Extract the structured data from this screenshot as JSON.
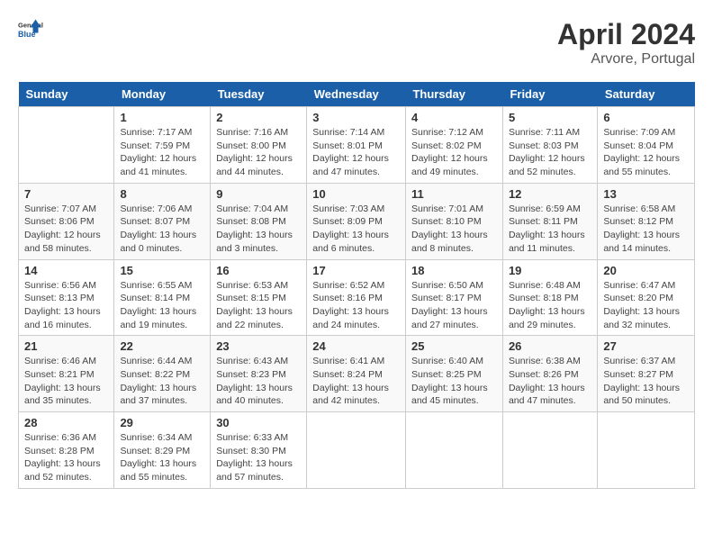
{
  "header": {
    "logo_text_general": "General",
    "logo_text_blue": "Blue",
    "month": "April 2024",
    "location": "Arvore, Portugal"
  },
  "weekdays": [
    "Sunday",
    "Monday",
    "Tuesday",
    "Wednesday",
    "Thursday",
    "Friday",
    "Saturday"
  ],
  "weeks": [
    [
      {
        "day": "",
        "info": ""
      },
      {
        "day": "1",
        "info": "Sunrise: 7:17 AM\nSunset: 7:59 PM\nDaylight: 12 hours\nand 41 minutes."
      },
      {
        "day": "2",
        "info": "Sunrise: 7:16 AM\nSunset: 8:00 PM\nDaylight: 12 hours\nand 44 minutes."
      },
      {
        "day": "3",
        "info": "Sunrise: 7:14 AM\nSunset: 8:01 PM\nDaylight: 12 hours\nand 47 minutes."
      },
      {
        "day": "4",
        "info": "Sunrise: 7:12 AM\nSunset: 8:02 PM\nDaylight: 12 hours\nand 49 minutes."
      },
      {
        "day": "5",
        "info": "Sunrise: 7:11 AM\nSunset: 8:03 PM\nDaylight: 12 hours\nand 52 minutes."
      },
      {
        "day": "6",
        "info": "Sunrise: 7:09 AM\nSunset: 8:04 PM\nDaylight: 12 hours\nand 55 minutes."
      }
    ],
    [
      {
        "day": "7",
        "info": "Sunrise: 7:07 AM\nSunset: 8:06 PM\nDaylight: 12 hours\nand 58 minutes."
      },
      {
        "day": "8",
        "info": "Sunrise: 7:06 AM\nSunset: 8:07 PM\nDaylight: 13 hours\nand 0 minutes."
      },
      {
        "day": "9",
        "info": "Sunrise: 7:04 AM\nSunset: 8:08 PM\nDaylight: 13 hours\nand 3 minutes."
      },
      {
        "day": "10",
        "info": "Sunrise: 7:03 AM\nSunset: 8:09 PM\nDaylight: 13 hours\nand 6 minutes."
      },
      {
        "day": "11",
        "info": "Sunrise: 7:01 AM\nSunset: 8:10 PM\nDaylight: 13 hours\nand 8 minutes."
      },
      {
        "day": "12",
        "info": "Sunrise: 6:59 AM\nSunset: 8:11 PM\nDaylight: 13 hours\nand 11 minutes."
      },
      {
        "day": "13",
        "info": "Sunrise: 6:58 AM\nSunset: 8:12 PM\nDaylight: 13 hours\nand 14 minutes."
      }
    ],
    [
      {
        "day": "14",
        "info": "Sunrise: 6:56 AM\nSunset: 8:13 PM\nDaylight: 13 hours\nand 16 minutes."
      },
      {
        "day": "15",
        "info": "Sunrise: 6:55 AM\nSunset: 8:14 PM\nDaylight: 13 hours\nand 19 minutes."
      },
      {
        "day": "16",
        "info": "Sunrise: 6:53 AM\nSunset: 8:15 PM\nDaylight: 13 hours\nand 22 minutes."
      },
      {
        "day": "17",
        "info": "Sunrise: 6:52 AM\nSunset: 8:16 PM\nDaylight: 13 hours\nand 24 minutes."
      },
      {
        "day": "18",
        "info": "Sunrise: 6:50 AM\nSunset: 8:17 PM\nDaylight: 13 hours\nand 27 minutes."
      },
      {
        "day": "19",
        "info": "Sunrise: 6:48 AM\nSunset: 8:18 PM\nDaylight: 13 hours\nand 29 minutes."
      },
      {
        "day": "20",
        "info": "Sunrise: 6:47 AM\nSunset: 8:20 PM\nDaylight: 13 hours\nand 32 minutes."
      }
    ],
    [
      {
        "day": "21",
        "info": "Sunrise: 6:46 AM\nSunset: 8:21 PM\nDaylight: 13 hours\nand 35 minutes."
      },
      {
        "day": "22",
        "info": "Sunrise: 6:44 AM\nSunset: 8:22 PM\nDaylight: 13 hours\nand 37 minutes."
      },
      {
        "day": "23",
        "info": "Sunrise: 6:43 AM\nSunset: 8:23 PM\nDaylight: 13 hours\nand 40 minutes."
      },
      {
        "day": "24",
        "info": "Sunrise: 6:41 AM\nSunset: 8:24 PM\nDaylight: 13 hours\nand 42 minutes."
      },
      {
        "day": "25",
        "info": "Sunrise: 6:40 AM\nSunset: 8:25 PM\nDaylight: 13 hours\nand 45 minutes."
      },
      {
        "day": "26",
        "info": "Sunrise: 6:38 AM\nSunset: 8:26 PM\nDaylight: 13 hours\nand 47 minutes."
      },
      {
        "day": "27",
        "info": "Sunrise: 6:37 AM\nSunset: 8:27 PM\nDaylight: 13 hours\nand 50 minutes."
      }
    ],
    [
      {
        "day": "28",
        "info": "Sunrise: 6:36 AM\nSunset: 8:28 PM\nDaylight: 13 hours\nand 52 minutes."
      },
      {
        "day": "29",
        "info": "Sunrise: 6:34 AM\nSunset: 8:29 PM\nDaylight: 13 hours\nand 55 minutes."
      },
      {
        "day": "30",
        "info": "Sunrise: 6:33 AM\nSunset: 8:30 PM\nDaylight: 13 hours\nand 57 minutes."
      },
      {
        "day": "",
        "info": ""
      },
      {
        "day": "",
        "info": ""
      },
      {
        "day": "",
        "info": ""
      },
      {
        "day": "",
        "info": ""
      }
    ]
  ]
}
